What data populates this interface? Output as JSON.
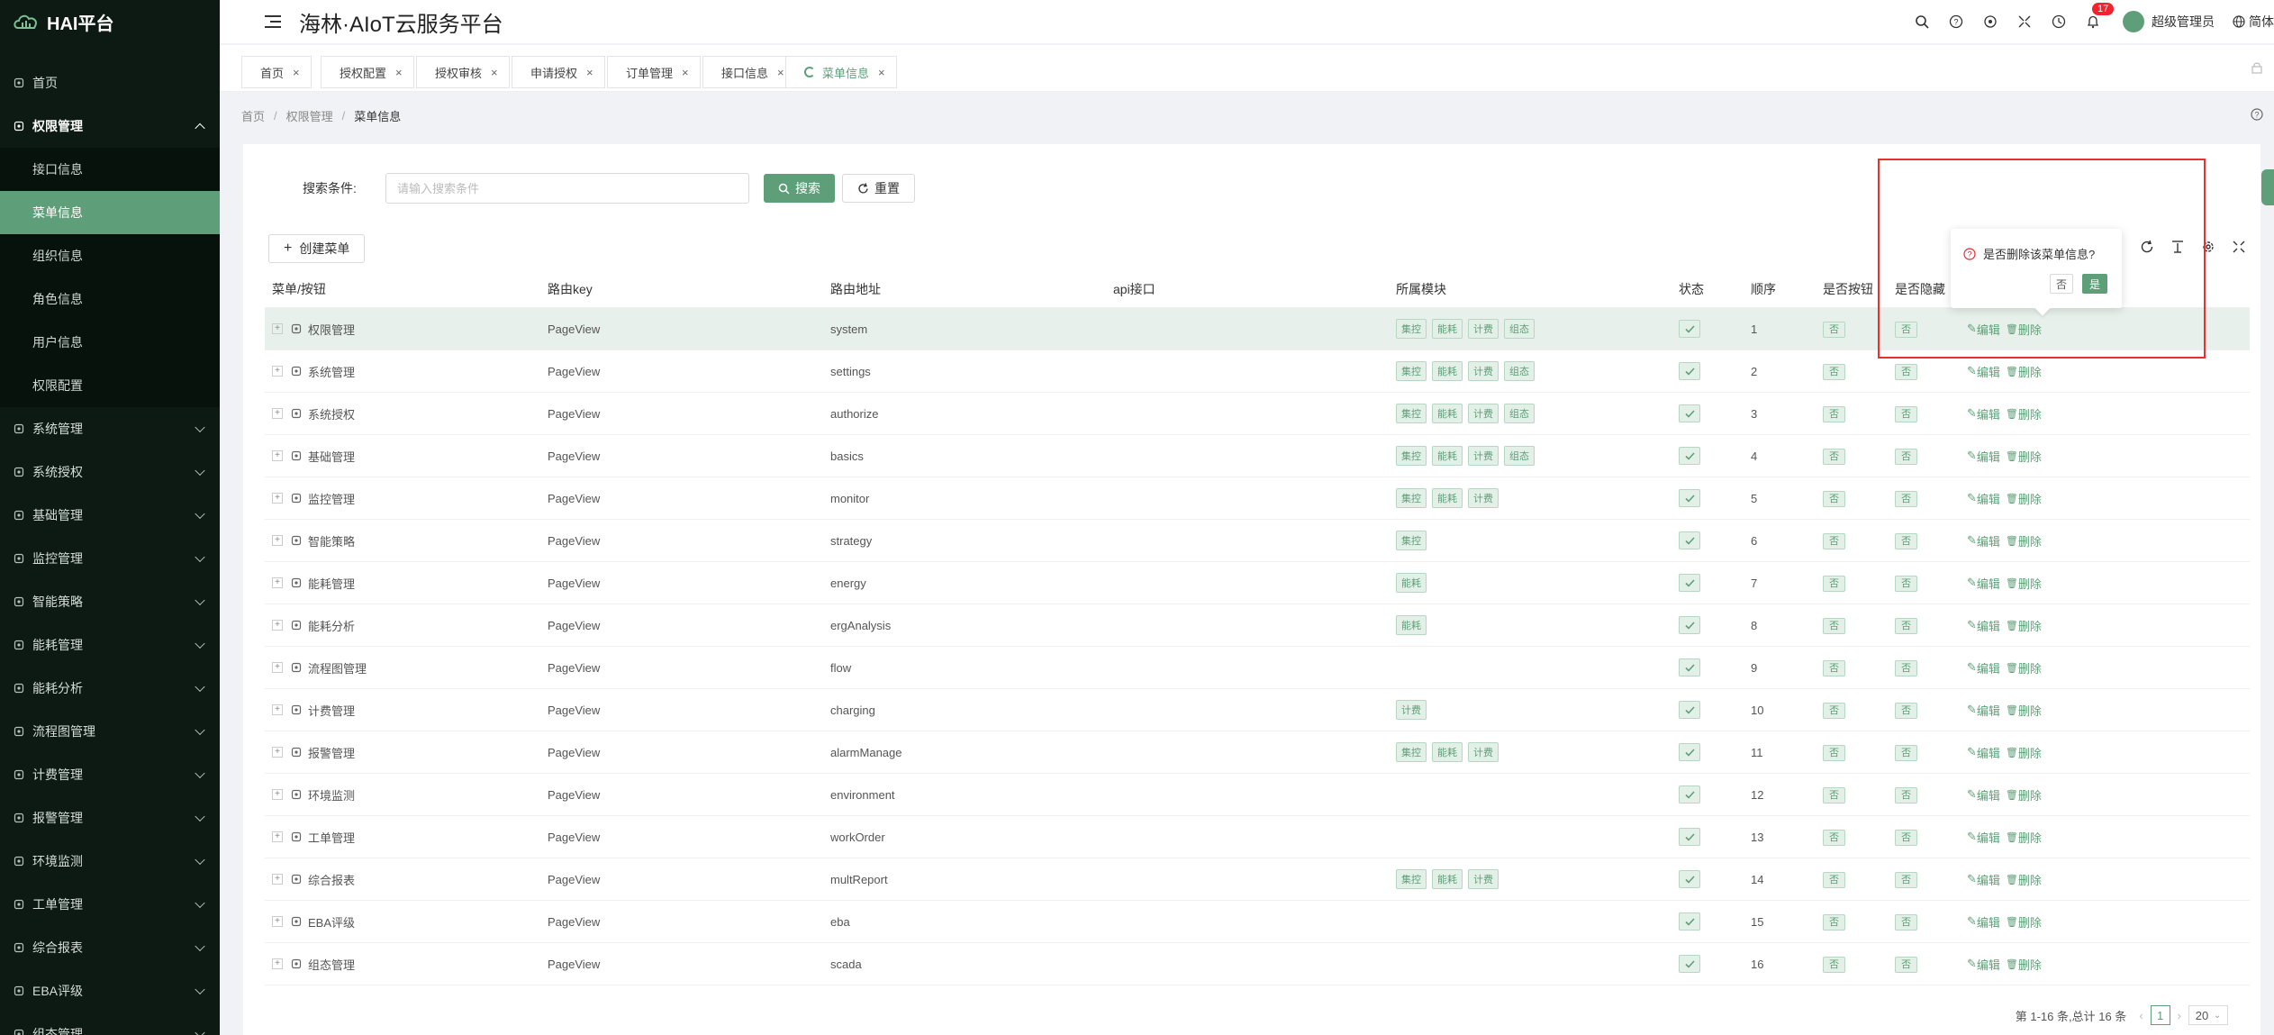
{
  "app": {
    "logo_text": "HAI平台",
    "title": "海林·AIoT云服务平台"
  },
  "header": {
    "notify_count": "17",
    "user_name": "超级管理员",
    "language": "简体"
  },
  "sidebar": {
    "items": [
      {
        "label": "首页",
        "icon": "home-icon"
      },
      {
        "label": "权限管理",
        "icon": "shield-icon",
        "open": true,
        "children": [
          {
            "label": "接口信息"
          },
          {
            "label": "菜单信息",
            "active": true
          },
          {
            "label": "组织信息"
          },
          {
            "label": "角色信息"
          },
          {
            "label": "用户信息"
          },
          {
            "label": "权限配置"
          }
        ]
      },
      {
        "label": "系统管理",
        "icon": "monitor-icon"
      },
      {
        "label": "系统授权",
        "icon": "authorize-icon"
      },
      {
        "label": "基础管理",
        "icon": "basics-icon"
      },
      {
        "label": "监控管理",
        "icon": "camera-icon"
      },
      {
        "label": "智能策略",
        "icon": "bulb-icon"
      },
      {
        "label": "能耗管理",
        "icon": "sliders-icon"
      },
      {
        "label": "能耗分析",
        "icon": "chart-icon"
      },
      {
        "label": "流程图管理",
        "icon": "flow-icon"
      },
      {
        "label": "计费管理",
        "icon": "billing-icon"
      },
      {
        "label": "报警管理",
        "icon": "alarm-icon"
      },
      {
        "label": "环境监测",
        "icon": "leaf-icon"
      },
      {
        "label": "工单管理",
        "icon": "layers-icon"
      },
      {
        "label": "综合报表",
        "icon": "report-icon"
      },
      {
        "label": "EBA评级",
        "icon": "rating-icon"
      },
      {
        "label": "组态管理",
        "icon": "scada-icon"
      }
    ]
  },
  "tabs": [
    {
      "label": "首页"
    },
    {
      "label": "授权配置"
    },
    {
      "label": "授权审核"
    },
    {
      "label": "申请授权"
    },
    {
      "label": "订单管理"
    },
    {
      "label": "接口信息"
    },
    {
      "label": "菜单信息",
      "active": true
    }
  ],
  "breadcrumb": [
    "首页",
    "权限管理",
    "菜单信息"
  ],
  "search": {
    "label": "搜索条件:",
    "placeholder": "请输入搜索条件",
    "value": "",
    "search_btn": "搜索",
    "reset_btn": "重置"
  },
  "toolbar": {
    "create_btn": "创建菜单"
  },
  "table": {
    "columns": [
      "菜单/按钮",
      "路由key",
      "路由地址",
      "api接口",
      "所属模块",
      "状态",
      "顺序",
      "是否按钮",
      "是否隐藏",
      ""
    ],
    "rows": [
      {
        "name": "权限管理",
        "icon": "shield-icon",
        "key": "PageView",
        "path": "system",
        "api": "",
        "modules": [
          "集控",
          "能耗",
          "计费",
          "组态"
        ],
        "order": "1",
        "is_button": "否",
        "hidden": "否"
      },
      {
        "name": "系统管理",
        "icon": "monitor-icon",
        "key": "PageView",
        "path": "settings",
        "api": "",
        "modules": [
          "集控",
          "能耗",
          "计费",
          "组态"
        ],
        "order": "2",
        "is_button": "否",
        "hidden": "否"
      },
      {
        "name": "系统授权",
        "icon": "authorize-icon",
        "key": "PageView",
        "path": "authorize",
        "api": "",
        "modules": [
          "集控",
          "能耗",
          "计费",
          "组态"
        ],
        "order": "3",
        "is_button": "否",
        "hidden": "否"
      },
      {
        "name": "基础管理",
        "icon": "basics-icon",
        "key": "PageView",
        "path": "basics",
        "api": "",
        "modules": [
          "集控",
          "能耗",
          "计费",
          "组态"
        ],
        "order": "4",
        "is_button": "否",
        "hidden": "否"
      },
      {
        "name": "监控管理",
        "icon": "camera-icon",
        "key": "PageView",
        "path": "monitor",
        "api": "",
        "modules": [
          "集控",
          "能耗",
          "计费"
        ],
        "order": "5",
        "is_button": "否",
        "hidden": "否"
      },
      {
        "name": "智能策略",
        "icon": "bulb-icon",
        "key": "PageView",
        "path": "strategy",
        "api": "",
        "modules": [
          "集控"
        ],
        "order": "6",
        "is_button": "否",
        "hidden": "否"
      },
      {
        "name": "能耗管理",
        "icon": "sliders-icon",
        "key": "PageView",
        "path": "energy",
        "api": "",
        "modules": [
          "能耗"
        ],
        "order": "7",
        "is_button": "否",
        "hidden": "否"
      },
      {
        "name": "能耗分析",
        "icon": "chart-icon",
        "key": "PageView",
        "path": "ergAnalysis",
        "api": "",
        "modules": [
          "能耗"
        ],
        "order": "8",
        "is_button": "否",
        "hidden": "否"
      },
      {
        "name": "流程图管理",
        "icon": "flow-icon",
        "key": "PageView",
        "path": "flow",
        "api": "",
        "modules": [],
        "order": "9",
        "is_button": "否",
        "hidden": "否"
      },
      {
        "name": "计费管理",
        "icon": "billing-icon",
        "key": "PageView",
        "path": "charging",
        "api": "",
        "modules": [
          "计费"
        ],
        "order": "10",
        "is_button": "否",
        "hidden": "否"
      },
      {
        "name": "报警管理",
        "icon": "alarm-icon",
        "key": "PageView",
        "path": "alarmManage",
        "api": "",
        "modules": [
          "集控",
          "能耗",
          "计费"
        ],
        "order": "11",
        "is_button": "否",
        "hidden": "否"
      },
      {
        "name": "环境监测",
        "icon": "leaf-icon",
        "key": "PageView",
        "path": "environment",
        "api": "",
        "modules": [],
        "order": "12",
        "is_button": "否",
        "hidden": "否"
      },
      {
        "name": "工单管理",
        "icon": "layers-icon",
        "key": "PageView",
        "path": "workOrder",
        "api": "",
        "modules": [],
        "order": "13",
        "is_button": "否",
        "hidden": "否"
      },
      {
        "name": "综合报表",
        "icon": "report-icon",
        "key": "PageView",
        "path": "multReport",
        "api": "",
        "modules": [
          "集控",
          "能耗",
          "计费"
        ],
        "order": "14",
        "is_button": "否",
        "hidden": "否"
      },
      {
        "name": "EBA评级",
        "icon": "rating-icon",
        "key": "PageView",
        "path": "eba",
        "api": "",
        "modules": [],
        "order": "15",
        "is_button": "否",
        "hidden": "否"
      },
      {
        "name": "组态管理",
        "icon": "scada-icon",
        "key": "PageView",
        "path": "scada",
        "api": "",
        "modules": [],
        "order": "16",
        "is_button": "否",
        "hidden": "否"
      }
    ],
    "edit_label": "编辑",
    "delete_label": "删除"
  },
  "popconfirm": {
    "message": "是否删除该菜单信息?",
    "no_label": "否",
    "yes_label": "是"
  },
  "pagination": {
    "summary": "第 1-16 条,总计 16 条",
    "current_page": "1",
    "page_size": "20"
  },
  "colors": {
    "primary": "#5e9e78",
    "sidebar_bg": "#0c1a13",
    "highlight_box": "#e8302e"
  }
}
